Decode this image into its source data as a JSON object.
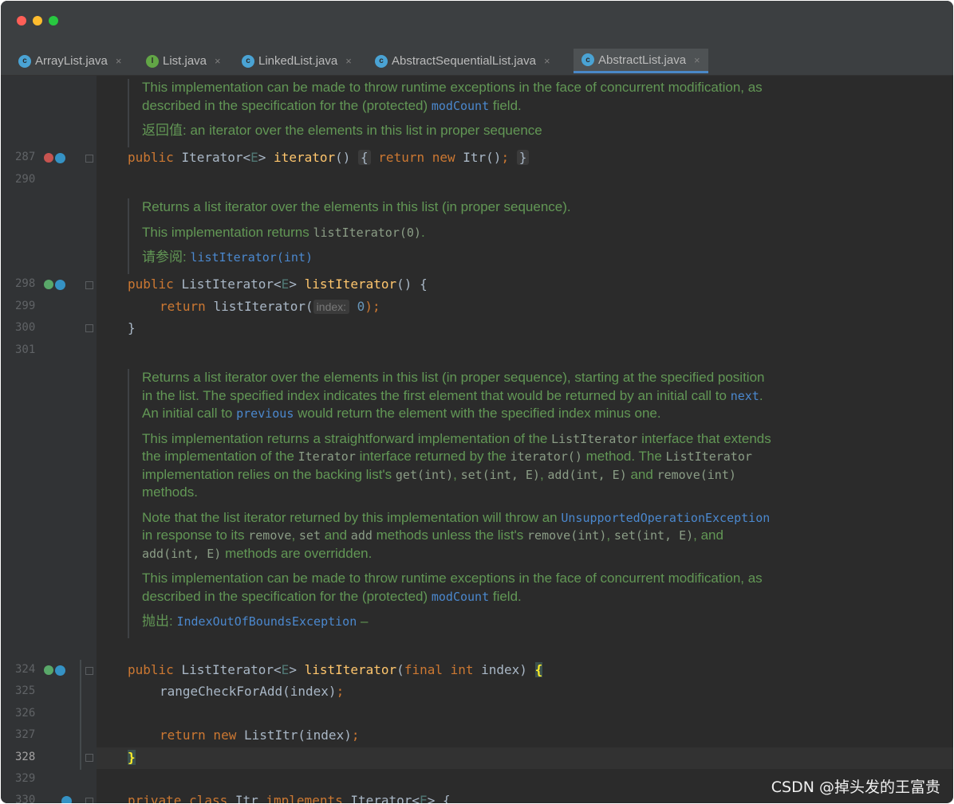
{
  "tabs": [
    {
      "label": "ArrayList.java",
      "icon": "class-icon",
      "icon_text": "c",
      "active": false
    },
    {
      "label": "List.java",
      "icon": "interface-icon",
      "icon_text": "I",
      "active": false
    },
    {
      "label": "LinkedList.java",
      "icon": "class-icon",
      "icon_text": "c",
      "active": false
    },
    {
      "label": "AbstractSequentialList.java",
      "icon": "class-icon",
      "icon_text": "c",
      "active": false
    },
    {
      "label": "AbstractList.java",
      "icon": "class-icon",
      "icon_text": "c",
      "active": true
    }
  ],
  "close_glyph": "×",
  "line_numbers": [
    "287",
    "290",
    "298",
    "299",
    "300",
    "301",
    "324",
    "325",
    "326",
    "327",
    "328",
    "329",
    "330"
  ],
  "docs": {
    "d1": {
      "p1_a": "This implementation can be made to throw runtime exceptions in the face of concurrent modification, as described in the specification for the (protected) ",
      "p1_link": "modCount",
      "p1_b": " field.",
      "p2_label": "返回值:",
      "p2_text": " an iterator over the elements in this list in proper sequence"
    },
    "d2": {
      "p1": "Returns a list iterator over the elements in this list (in proper sequence).",
      "p2_a": "This implementation returns ",
      "p2_code": "listIterator(0)",
      "p2_b": ".",
      "p3_label": "请参阅:",
      "p3_link": "listIterator(int)"
    },
    "d3": {
      "p1_a": "Returns a list iterator over the elements in this list (in proper sequence), starting at the specified position in the list. The specified index indicates the first element that would be returned by an initial call to ",
      "p1_next": "next",
      "p1_b": ". An initial call to ",
      "p1_prev": "previous",
      "p1_c": " would return the element with the specified index minus one.",
      "p2_a": "This implementation returns a straightforward implementation of the ",
      "p2_c1": "ListIterator",
      "p2_b": " interface that extends the implementation of the ",
      "p2_c2": "Iterator",
      "p2_c": " interface returned by the ",
      "p2_c3": "iterator()",
      "p2_d": " method. The ",
      "p2_c4": "ListIterator",
      "p2_e": " implementation relies on the backing list's ",
      "p2_c5": "get(int)",
      "p2_f": ", ",
      "p2_c6": "set(int, E)",
      "p2_g": ", ",
      "p2_c7": "add(int, E)",
      "p2_h": " and ",
      "p2_c8": "remove(int)",
      "p2_i": " methods.",
      "p3_a": "Note that the list iterator returned by this implementation will throw an ",
      "p3_link": "UnsupportedOperationException",
      "p3_b": " in response to its ",
      "p3_c1": "remove",
      "p3_c": ", ",
      "p3_c2": "set",
      "p3_d": " and ",
      "p3_c3": "add",
      "p3_e": " methods unless the list's ",
      "p3_c4": "remove(int)",
      "p3_f": ", ",
      "p3_c5": "set(int, E)",
      "p3_g": ", and ",
      "p3_c6": "add(int, E)",
      "p3_h": " methods are overridden.",
      "p4_a": "This implementation can be made to throw runtime exceptions in the face of concurrent modification, as described in the specification for the (protected) ",
      "p4_link": "modCount",
      "p4_b": " field.",
      "p5_label": "抛出:",
      "p5_link": "IndexOutOfBoundsException",
      "p5_b": " –"
    }
  },
  "code": {
    "l287": {
      "kw": "public ",
      "type": "Iterator<",
      "tp": "E",
      "type2": "> ",
      "fn": "iterator",
      "paren": "()",
      "open": "{",
      "kw2": "return new ",
      "rest": "Itr()",
      "semi": ";",
      "close": "}"
    },
    "l298": {
      "kw": "public ",
      "type": "ListIterator<",
      "tp": "E",
      "type2": "> ",
      "fn": "listIterator",
      "rest": "() {"
    },
    "l299": {
      "kw": "return ",
      "call": "listIterator(",
      "hint": "index:",
      "num": "0",
      "end": ");"
    },
    "l300": {
      "text": "}"
    },
    "l324": {
      "kw": "public ",
      "type": "ListIterator<",
      "tp": "E",
      "type2": "> ",
      "fn": "listIterator",
      "args_a": "(",
      "kw2": "final int ",
      "args_b": "index) ",
      "brace": "{"
    },
    "l325": {
      "text": "rangeCheckForAdd(index)",
      "semi": ";"
    },
    "l327": {
      "kw": "return new ",
      "text": "ListItr(index)",
      "semi": ";"
    },
    "l328": {
      "brace": "}"
    },
    "l330": {
      "kw": "private class ",
      "text": "Itr ",
      "kw2": "implements ",
      "type": "Iterator<",
      "tp": "E",
      "rest": "> {"
    }
  },
  "watermark": "CSDN @掉头发的王富贵",
  "colors": {
    "background": "#2b2b2b",
    "keyword": "#cc7832",
    "method": "#ffc66d",
    "doc": "#629755",
    "link": "#4b88ce"
  }
}
